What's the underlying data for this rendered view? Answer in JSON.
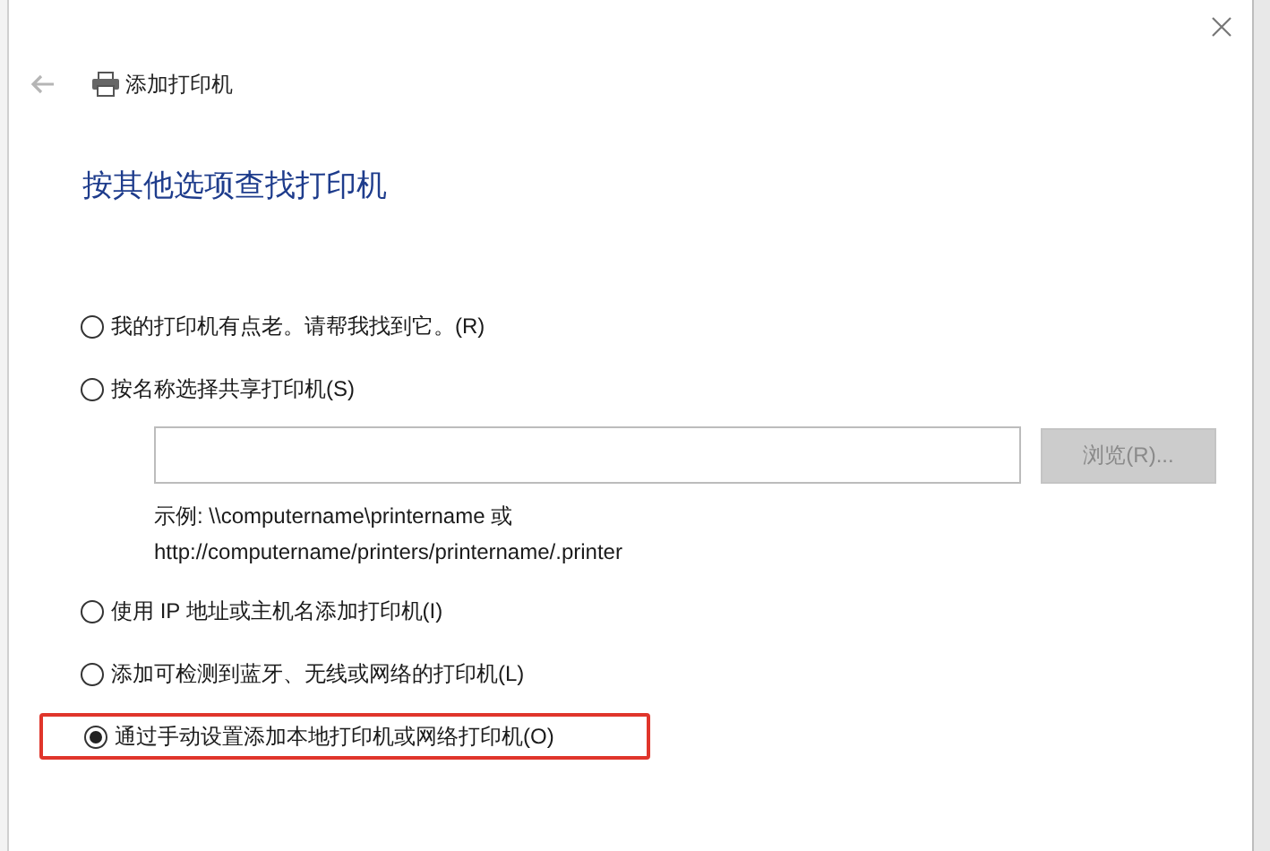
{
  "window": {
    "title": "添加打印机"
  },
  "heading": "按其他选项查找打印机",
  "options": [
    {
      "label": "我的打印机有点老。请帮我找到它。(R)",
      "selected": false,
      "highlighted": false
    },
    {
      "label": "按名称选择共享打印机(S)",
      "selected": false,
      "highlighted": false,
      "field": {
        "button": "浏览(R)...",
        "button_disabled": true,
        "example": [
          "示例: \\\\computername\\printername 或",
          "http://computername/printers/printername/.printer"
        ]
      }
    },
    {
      "label": "使用 IP 地址或主机名添加打印机(I)",
      "selected": false,
      "highlighted": false
    },
    {
      "label": "添加可检测到蓝牙、无线或网络的打印机(L)",
      "selected": false,
      "highlighted": false
    },
    {
      "label": "通过手动设置添加本地打印机或网络打印机(O)",
      "selected": true,
      "highlighted": true
    }
  ]
}
